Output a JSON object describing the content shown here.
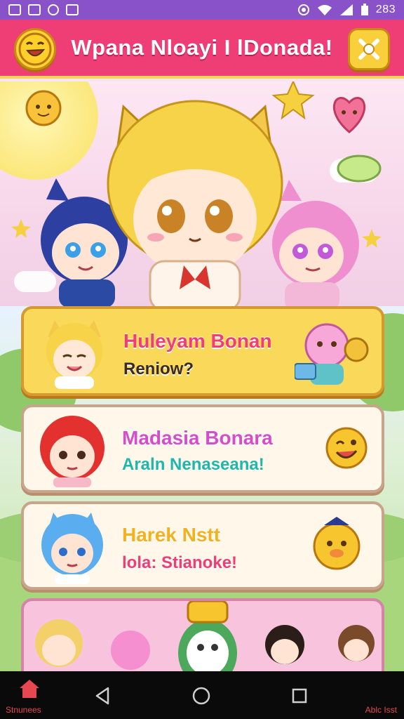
{
  "status_bar": {
    "time": "283",
    "left_icons": [
      "gallery-icon",
      "sim-icon",
      "sync-icon",
      "game-icon"
    ],
    "right_icons": [
      "location-icon",
      "wifi-icon",
      "signal-icon",
      "battery-icon"
    ]
  },
  "header": {
    "title": "Wpana Nloayi I lDonada!",
    "left_button_icon": "smiley-face-icon",
    "right_button_icon": "crossed-bones-icon"
  },
  "menu": [
    {
      "title": "Huleyam Bonan",
      "subtitle": "Reniow?",
      "title_color": "#ef3d76",
      "subtitle_color": "#3a2a22",
      "style": "yellow"
    },
    {
      "title": "Madasia Bonara",
      "subtitle": "Araln Nenaseana!",
      "title_color": "#d24fc9",
      "subtitle_color": "#1fb7a8",
      "style": "cream"
    },
    {
      "title": "Harek Nstt",
      "subtitle": "lola: Stianoke!",
      "title_color": "#f2b21f",
      "subtitle_color": "#ef3d76",
      "style": "cream"
    }
  ],
  "nav": {
    "left_label": "Stnunees",
    "right_label": "Ablc Isst",
    "home_icon": "home-icon"
  },
  "colors": {
    "accent_pink": "#ef3d76",
    "accent_yellow": "#f9d85a",
    "status_purple": "#8a52c9"
  }
}
